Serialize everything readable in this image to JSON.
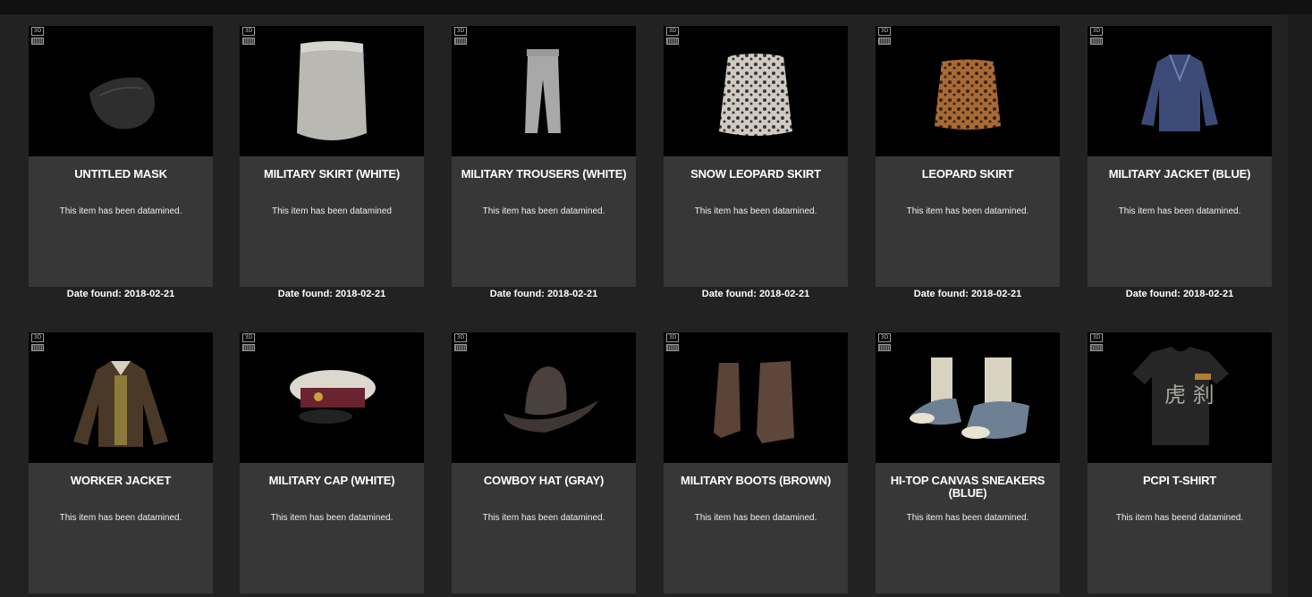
{
  "items": [
    {
      "title": "UNTITLED MASK",
      "desc": "This item has been datamined.",
      "date": "Date found: 2018-02-21",
      "badge": "3D",
      "icon": "mask-icon"
    },
    {
      "title": "MILITARY SKIRT (WHITE)",
      "desc": "This item has been datamined",
      "date": "Date found: 2018-02-21",
      "badge": "3D",
      "icon": "skirt-icon"
    },
    {
      "title": "MILITARY TROUSERS (WHITE)",
      "desc": "This item has been datamined.",
      "date": "Date found: 2018-02-21",
      "badge": "3D",
      "icon": "trousers-icon"
    },
    {
      "title": "SNOW LEOPARD SKIRT",
      "desc": "This item has been datamined.",
      "date": "Date found: 2018-02-21",
      "badge": "3D",
      "icon": "skirt-icon"
    },
    {
      "title": "LEOPARD SKIRT",
      "desc": "This item has been datamined.",
      "date": "Date found: 2018-02-21",
      "badge": "3D",
      "icon": "skirt-icon"
    },
    {
      "title": "MILITARY JACKET (BLUE)",
      "desc": "This item has been datamined.",
      "date": "Date found: 2018-02-21",
      "badge": "3D",
      "icon": "jacket-icon"
    },
    {
      "title": "WORKER JACKET",
      "desc": "This item has been datamined.",
      "date": "",
      "badge": "3D",
      "icon": "jacket-icon"
    },
    {
      "title": "MILITARY CAP (WHITE)",
      "desc": "This item has been datamined.",
      "date": "",
      "badge": "3D",
      "icon": "cap-icon"
    },
    {
      "title": "COWBOY HAT (GRAY)",
      "desc": "This item has been datamined.",
      "date": "",
      "badge": "3D",
      "icon": "hat-icon"
    },
    {
      "title": "MILITARY BOOTS (BROWN)",
      "desc": "This item has been datamined.",
      "date": "",
      "badge": "3D",
      "icon": "boots-icon"
    },
    {
      "title": "HI-TOP CANVAS SNEAKERS (BLUE)",
      "desc": "This item has been datamined.",
      "date": "",
      "badge": "3D",
      "icon": "sneakers-icon"
    },
    {
      "title": "PCPI T-SHIRT",
      "desc": "This item has beend datamined.",
      "date": "",
      "badge": "3D",
      "icon": "tshirt-icon"
    }
  ]
}
